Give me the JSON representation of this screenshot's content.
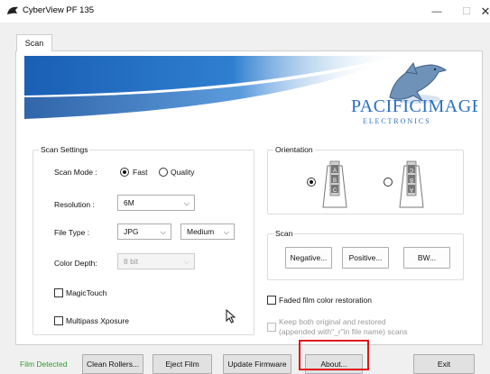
{
  "window": {
    "title": "CyberView PF 135",
    "minimize_glyph": "—",
    "maximize_glyph": "☐",
    "close_glyph": "✕"
  },
  "tabs": [
    {
      "label": "Scan",
      "active": true
    }
  ],
  "banner": {
    "brand_line1": "PACIFICIMAGE",
    "brand_line2": "E L E C T R O N I C S",
    "brand_color": "#2c6fbf",
    "stripe_color": "#1f64b8"
  },
  "scan_settings": {
    "title": "Scan Settings",
    "scan_mode": {
      "label": "Scan Mode :",
      "options": [
        "Fast",
        "Quality"
      ],
      "selected": "Fast"
    },
    "resolution": {
      "label": "Resolution :",
      "value": "6M"
    },
    "file_type": {
      "label": "File Type :",
      "value": "JPG",
      "quality_value": "Medium"
    },
    "color_depth": {
      "label": "Color Depth:",
      "value": "8 bit",
      "disabled": true
    },
    "magic_touch": {
      "label": "MagicTouch",
      "checked": false
    },
    "multipass": {
      "label": "Multipass Xposure",
      "checked": false
    }
  },
  "orientation": {
    "title": "Orientation",
    "options": [
      "landscape",
      "portrait"
    ],
    "selected": 0
  },
  "scan_group": {
    "title": "Scan",
    "buttons": [
      "Negative...",
      "Positive...",
      "BW..."
    ]
  },
  "restoration": {
    "faded_label": "Faded film color restoration",
    "keep_line1": "Keep both original and restored",
    "keep_line2": "(appended with\"_r\"in file name) scans"
  },
  "bottom": {
    "status": "Film Detected",
    "buttons": [
      "Clean Rollers...",
      "Eject Film",
      "Update Firmware",
      "About...",
      "Exit"
    ]
  }
}
